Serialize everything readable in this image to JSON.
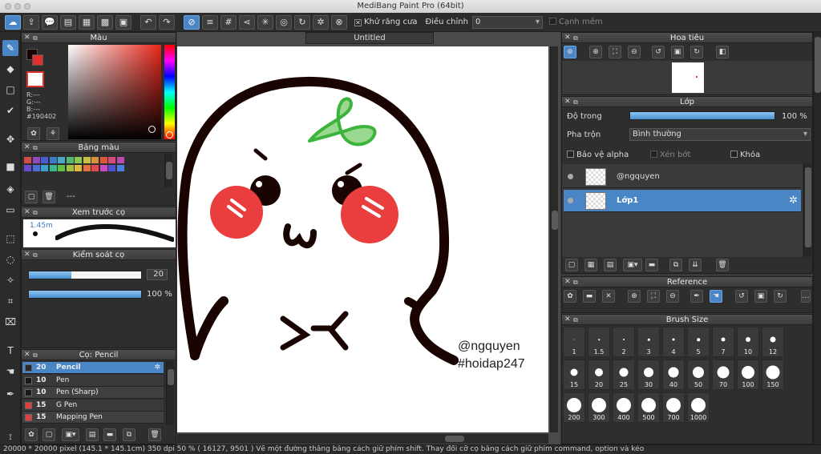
{
  "window": {
    "title": "MediBang Paint Pro (64bit)"
  },
  "toolbar": {
    "antialias_label": "Khử răng cưa",
    "adjust_label": "Điều chỉnh",
    "adjust_value": "0",
    "smooth_label": "Cạnh mềm"
  },
  "color_panel": {
    "title": "Màu",
    "r": "R:---",
    "g": "G:---",
    "b": "B:---",
    "hex": "#190402"
  },
  "palette_panel": {
    "title": "Bảng màu",
    "placeholder": "---",
    "colors": [
      "#d34a4a",
      "#8f4ab8",
      "#4a5ad0",
      "#3a7ac8",
      "#48a8c8",
      "#50b870",
      "#8ac850",
      "#c8c040",
      "#d8903a",
      "#d85a3a",
      "#d84a7a",
      "#b84ab0",
      "#6a4ad0",
      "#4a70d8",
      "#3aa0d0",
      "#3ab890",
      "#60c040",
      "#a0c040",
      "#e0b840",
      "#e07040",
      "#e04a4a",
      "#cc4ac0",
      "#5050d0",
      "#4a80e0"
    ]
  },
  "brush_preview_panel": {
    "title": "Xem trước cọ",
    "size_label": "1.45m"
  },
  "brush_control_panel": {
    "title": "Kiểm soát cọ",
    "size_value": "20",
    "opacity_value": "100 %",
    "size_fraction": 0.38,
    "opacity_fraction": 1.0
  },
  "brush_panel": {
    "title": "Cọ: Pencil",
    "items": [
      {
        "size": "20",
        "name": "Pencil",
        "color": "#2a2a2a",
        "selected": true
      },
      {
        "size": "10",
        "name": "Pen",
        "color": "#1a1a1a",
        "selected": false
      },
      {
        "size": "10",
        "name": "Pen (Sharp)",
        "color": "#1a1a1a",
        "selected": false
      },
      {
        "size": "15",
        "name": "G Pen",
        "color": "#e04040",
        "selected": false
      },
      {
        "size": "15",
        "name": "Mapping Pen",
        "color": "#e04040",
        "selected": false
      }
    ]
  },
  "canvas": {
    "tab_title": "Untitled",
    "watermark_line1": "@ngquyen",
    "watermark_line2": "#hoidap247"
  },
  "navigator_panel": {
    "title": "Hoa tiêu"
  },
  "layer_panel": {
    "title": "Lớp",
    "opacity_label": "Độ trong",
    "opacity_value": "100 %",
    "opacity_fraction": 1.0,
    "blend_label": "Pha trộn",
    "blend_value": "Bình thường",
    "protect_alpha": "Bảo vệ alpha",
    "clipping": "Xén bớt",
    "lock": "Khóa",
    "layers": [
      {
        "name": "@ngquyen",
        "selected": false
      },
      {
        "name": "Lớp1",
        "selected": true
      }
    ]
  },
  "reference_panel": {
    "title": "Reference"
  },
  "brush_size_panel": {
    "title": "Brush Size",
    "sizes": [
      "1",
      "1.5",
      "2",
      "3",
      "4",
      "5",
      "7",
      "10",
      "12",
      "15",
      "20",
      "25",
      "30",
      "40",
      "50",
      "70",
      "100",
      "150",
      "200",
      "300",
      "400",
      "500",
      "700",
      "1000"
    ]
  },
  "statusbar": {
    "text": "20000 * 20000 pixel   (145.1 * 145.1cm)   350 dpi   50 %   ( 16127, 9501 )   Vẽ một đường thẳng bằng cách giữ phím shift. Thay đổi cỡ cọ bằng cách giữ phím command, option và kéo"
  }
}
